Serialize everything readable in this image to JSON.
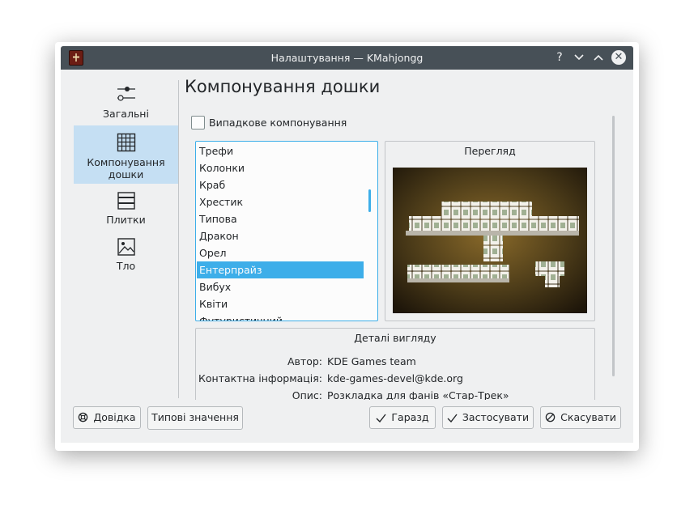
{
  "window": {
    "title": "Налаштування — KMahjongg"
  },
  "titlebar": {
    "help": "?",
    "minimize": "⌄",
    "maximize": "⌃",
    "close": "✕"
  },
  "sidebar": {
    "items": [
      {
        "label": "Загальні",
        "icon": "sliders-icon"
      },
      {
        "label": "Компонування\nдошки",
        "icon": "grid-icon",
        "active": true
      },
      {
        "label": "Плитки",
        "icon": "tiles-icon"
      },
      {
        "label": "Тло",
        "icon": "image-icon"
      }
    ]
  },
  "page": {
    "title": "Компонування дошки"
  },
  "random_layout": {
    "label": "Випадкове компонування",
    "checked": false
  },
  "layouts": {
    "items": [
      "Трефи",
      "Колонки",
      "Краб",
      "Хрестик",
      "Типова",
      "Дракон",
      "Орел",
      "Ентерпрайз",
      "Вибух",
      "Квіти",
      "Футуристичний"
    ],
    "selected": "Ентерпрайз"
  },
  "preview": {
    "title": "Перегляд"
  },
  "details": {
    "title": "Деталі вигляду",
    "author_label": "Автор:",
    "author": "KDE Games team",
    "contact_label": "Контактна інформація:",
    "contact": "kde-games-devel@kde.org",
    "desc_label": "Опис:",
    "desc": "Розкладка для фанів «Стар-Трек»"
  },
  "buttons": {
    "help": "Довідка",
    "defaults": "Типові значення",
    "ok": "Гаразд",
    "apply": "Застосувати",
    "cancel": "Скасувати"
  },
  "colors": {
    "accent": "#3daee9",
    "titlebar": "#475057",
    "window": "#eff0f1",
    "selection_sidebar": "#c5dff3"
  }
}
